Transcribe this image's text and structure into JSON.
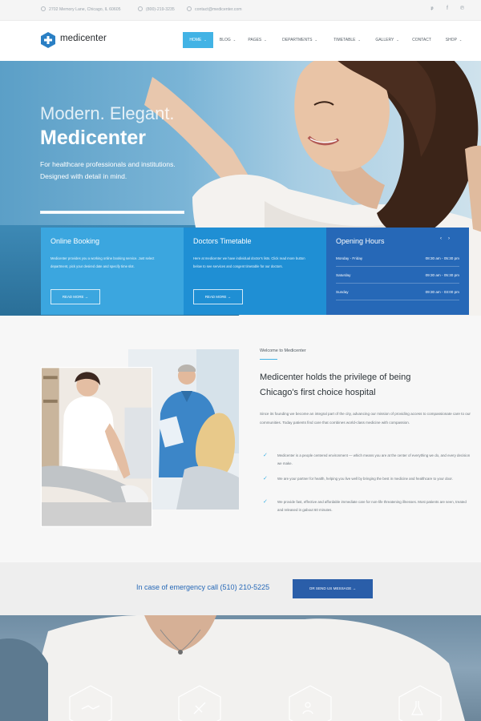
{
  "topbar": {
    "address": "2702 Memory Lane, Chicago, IL 60605",
    "phone": "(800)-219-3235",
    "email": "contact@medicenter.com",
    "social_icons": [
      "twitter-icon",
      "facebook-icon",
      "pinterest-icon"
    ]
  },
  "header": {
    "logo_text": "medicenter",
    "nav": [
      "HOME",
      "BLOG",
      "PAGES",
      "DEPARTMENTS",
      "TIMETABLE",
      "GALLERY",
      "CONTACT",
      "SHOP"
    ],
    "active_nav": "HOME"
  },
  "hero": {
    "kicker": "Modern. Elegant.",
    "title": "Medicenter",
    "subtitle_line1": "For healthcare professionals and institutions.",
    "subtitle_line2": "Designed with detail in mind.",
    "slider_progress": 1.0
  },
  "boxes": {
    "booking": {
      "title": "Online Booking",
      "text": "Medicenter provides you a working online booking service. Just select department, pick your desired date and specify time slot.",
      "button": "READ MORE"
    },
    "timetable": {
      "title": "Doctors Timetable",
      "text": "Here at medicenter we have individual doctor's lists. Click read more button below to see services and congent timetable for our doctors.",
      "button": "READ MORE"
    },
    "hours": {
      "title": "Opening Hours",
      "rows": [
        {
          "day": "Monday - Friday",
          "time": "08:30 am - 05:30 pm"
        },
        {
          "day": "Saturday",
          "time": "09:30 am - 05:30 pm"
        },
        {
          "day": "Sunday",
          "time": "09:30 am - 03:00 pm"
        }
      ]
    }
  },
  "welcome": {
    "label": "Welcome to Medicenter",
    "title": "Medicenter holds the privilege of being Chicago's first choice hospital",
    "text": "Since its founding we become an integral part of the city, advancing our mission of providing access to compassionate care to our communities. Today patients find care that combines world-class medicine with compassion.",
    "checks": [
      "Medicenter is a people centered environment — which means you are at the center of everything we do, and every decision we make.",
      "We are your partner for health, helping you live well by bringing the best in medicine and healthcare to your door.",
      "We provide fast, effective and affordable immediate care for non-life threatening illnesses. Most patients are seen, treated and released in gabout 60 minutes."
    ]
  },
  "emergency": {
    "text": "In case of emergency call (510) 210-5225",
    "button": "OR SEND US MESSAGE"
  },
  "colors": {
    "accent": "#42b3e5",
    "box1": "#3ba6df",
    "box2": "#1f8fd4",
    "box3": "#2668b7"
  }
}
